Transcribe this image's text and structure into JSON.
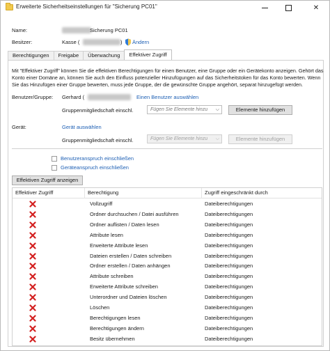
{
  "window": {
    "title": "Erweiterte Sicherheitseinstellungen für \"Sicherung PC01\"",
    "minimize": "minimize",
    "maximize": "maximize",
    "close": "✕"
  },
  "info": {
    "name_label": "Name:",
    "name_value": "Sicherung PC01",
    "owner_label": "Besitzer:",
    "owner_value": "Kasse (",
    "owner_close": ")",
    "change_link": "Ändern"
  },
  "tabs": [
    {
      "label": "Berechtigungen"
    },
    {
      "label": "Freigabe"
    },
    {
      "label": "Überwachung"
    },
    {
      "label": "Effektiver Zugriff"
    }
  ],
  "description": "Mit \"Effektiver Zugriff\" können Sie die effektiven Berechtigungen für einen Benutzer, eine Gruppe oder ein Gerätekonto anzeigen. Gehört das Konto einer Domäne an, können Sie auch den Einfluss potenzieller Hinzufügungen auf das Sicherheitstoken für das Konto bewerten. Wenn Sie das Hinzufügen einer Gruppe bewerten, muss jede Gruppe, der die gewünschte Gruppe angehört, separat hinzugefügt werden.",
  "user": {
    "label": "Benutzer/Gruppe:",
    "value": "Gerhard (",
    "select_link": "Einen Benutzer auswählen",
    "group_label": "Gruppenmitgliedschaft einschl.",
    "combo_placeholder": "Fügen Sie Elemente hinzu",
    "add_button": "Elemente hinzufügen"
  },
  "device": {
    "label": "Gerät:",
    "select_link": "Gerät auswählen",
    "group_label": "Gruppenmitgliedschaft einschl.",
    "combo_placeholder": "Fügen Sie Elemente hinzu",
    "add_button": "Elemente hinzufügen"
  },
  "links": {
    "user_claim": "Benutzeranspruch einschließen",
    "device_claim": "Geräteanspruch einschließen"
  },
  "show_button": "Effektiven Zugriff anzeigen",
  "table": {
    "headers": [
      "Effektiver Zugriff",
      "Berechtigung",
      "Zugriff eingeschränkt durch"
    ],
    "rows": [
      {
        "permission": "Vollzugriff",
        "restricted_by": "Dateiberechtigungen"
      },
      {
        "permission": "Ordner durchsuchen / Datei ausführen",
        "restricted_by": "Dateiberechtigungen"
      },
      {
        "permission": "Ordner auflisten / Daten lesen",
        "restricted_by": "Dateiberechtigungen"
      },
      {
        "permission": "Attribute lesen",
        "restricted_by": "Dateiberechtigungen"
      },
      {
        "permission": "Erweiterte Attribute lesen",
        "restricted_by": "Dateiberechtigungen"
      },
      {
        "permission": "Dateien erstellen / Daten schreiben",
        "restricted_by": "Dateiberechtigungen"
      },
      {
        "permission": "Ordner erstellen / Daten anhängen",
        "restricted_by": "Dateiberechtigungen"
      },
      {
        "permission": "Attribute schreiben",
        "restricted_by": "Dateiberechtigungen"
      },
      {
        "permission": "Erweiterte Attribute schreiben",
        "restricted_by": "Dateiberechtigungen"
      },
      {
        "permission": "Unterordner und Dateien löschen",
        "restricted_by": "Dateiberechtigungen"
      },
      {
        "permission": "Löschen",
        "restricted_by": "Dateiberechtigungen"
      },
      {
        "permission": "Berechtigungen lesen",
        "restricted_by": "Dateiberechtigungen"
      },
      {
        "permission": "Berechtigungen ändern",
        "restricted_by": "Dateiberechtigungen"
      },
      {
        "permission": "Besitz übernehmen",
        "restricted_by": "Dateiberechtigungen"
      }
    ]
  },
  "colors": {
    "link": "#1d5fb4",
    "deny_icon": "#d32020",
    "folder_icon": "#f2c94c"
  }
}
